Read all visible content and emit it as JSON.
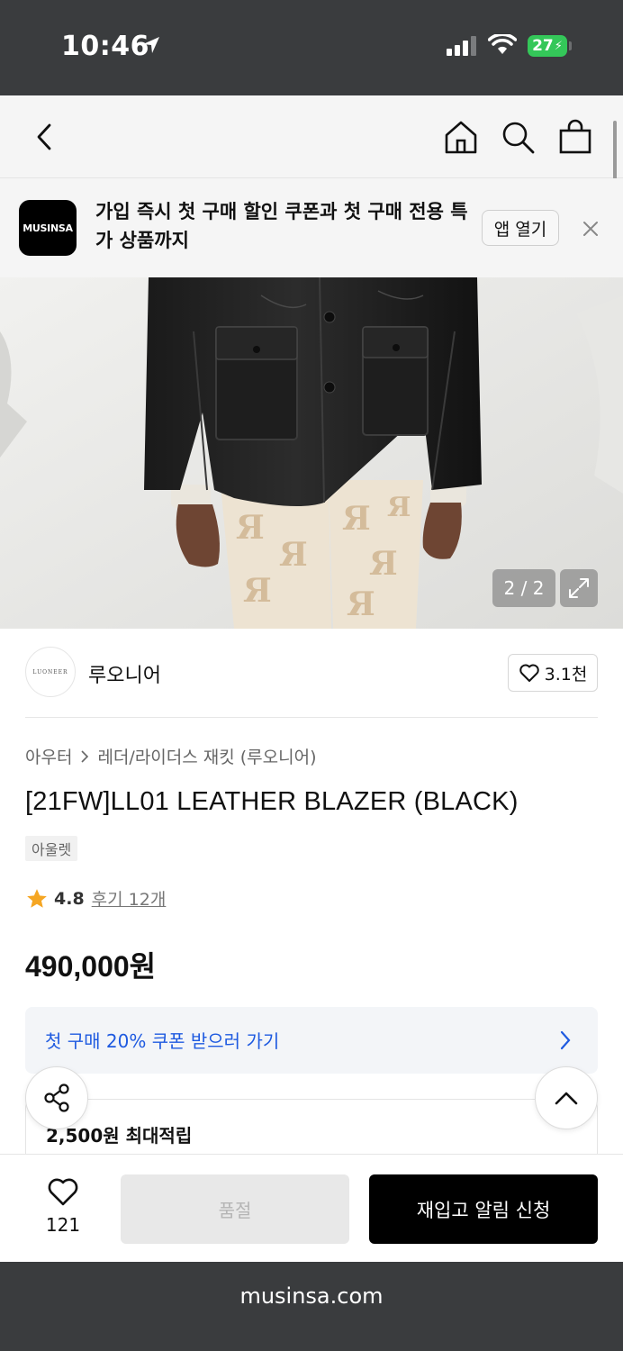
{
  "status_bar": {
    "time": "10:46",
    "battery": "27"
  },
  "nav": {
    "back": "back",
    "home": "home",
    "search": "search",
    "cart": "cart"
  },
  "promo": {
    "logo": "MUSINSA",
    "text": "가입 즉시 첫 구매 할인 쿠폰과 첫 구매 전용 특가 상품까지",
    "open_label": "앱 열기"
  },
  "gallery": {
    "pager": "2 / 2"
  },
  "brand": {
    "logo_text": "LUONEER",
    "name": "루오니어",
    "likes": "3.1천"
  },
  "product": {
    "breadcrumb": [
      "아우터",
      "레더/라이더스 재킷 (루오니어)"
    ],
    "title": "[21FW]LL01 LEATHER BLAZER (BLACK)",
    "tag": "아울렛",
    "rating": "4.8",
    "review_label": "후기 12개",
    "price": "490,000원"
  },
  "coupon": {
    "label": "첫 구매 20% 쿠폰 받으러 가기"
  },
  "points": {
    "label": "2,500원 최대적립"
  },
  "bottom": {
    "wish_count": "121",
    "soldout_label": "품절",
    "restock_label": "재입고 알림 신청"
  },
  "browser": {
    "url": "musinsa.com"
  },
  "colors": {
    "accent_blue": "#1e5ae0",
    "star": "#f5a623",
    "battery": "#34c759"
  }
}
